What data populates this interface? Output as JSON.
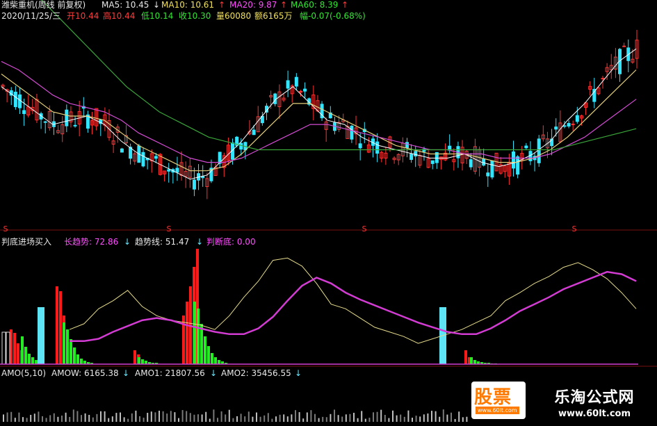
{
  "header": {
    "stock_name": "潍柴重机(周线 前复权)",
    "ma5": "MA5: 10.45",
    "ma5_arrow": "↓",
    "ma10": "MA10: 10.61",
    "ma10_arrow": "↑",
    "ma20": "MA20: 9.87",
    "ma20_arrow": "↑",
    "ma60": "MA60: 8.39",
    "ma60_arrow": "↑",
    "date": "2020/11/25/三",
    "open": "开10.44",
    "high": "高10.44",
    "low": "低10.14",
    "close": "收10.30",
    "volume": "量60080",
    "amount": "额6165万",
    "change": "幅-0.07(-0.68%)"
  },
  "indicator": {
    "name": "判底进场买入",
    "long_trend": "长趋势: 72.86",
    "long_trend_arrow": "↓",
    "trend_line": "趋势线: 51.47",
    "trend_line_arrow": "↓",
    "bottom": "判断底: 0.00"
  },
  "amo": {
    "name": "AMO(5,10)",
    "amow": "AMOW: 6165.38",
    "amow_arrow": "↓",
    "amo1": "AMO1: 21807.56",
    "amo1_arrow": "↓",
    "amo2": "AMO2: 35456.55",
    "amo2_arrow": "↓"
  },
  "markers": [
    "S",
    "S",
    "S",
    "S"
  ],
  "watermark": {
    "logo": "股票",
    "logo_sub": "www.60lt.com",
    "site_name": "乐淘公式网",
    "site_url": "www.60lt.com"
  },
  "colors": {
    "up": "#ff3333",
    "down": "#33e6ff",
    "ma5": "#ffffff",
    "ma10": "#e6d07a",
    "ma20": "#d24bd2",
    "ma60": "#3aa63a",
    "trend": "#e6dc8c",
    "long_trend": "#d23cd2",
    "bar_red": "#ff1a1a",
    "bar_green": "#22ee22",
    "bar_cyan": "#5de4f5"
  },
  "chart_data": [
    {
      "type": "candlestick",
      "title": "潍柴重机(周线 前复权)",
      "series": [
        {
          "name": "MA5",
          "values": [
            11.2,
            10.9,
            10.6,
            10.3,
            10.4,
            10.5,
            10.3,
            9.9,
            9.6,
            9.4,
            9.2,
            9.0,
            9.1,
            9.5,
            9.9,
            10.4,
            10.9,
            11.2,
            10.8,
            10.4,
            10.3,
            10.0,
            9.8,
            9.7,
            9.6,
            9.5,
            9.5,
            9.6,
            9.4,
            9.3,
            9.4,
            9.6,
            9.9,
            10.4,
            10.8,
            11.3,
            11.8,
            12.1
          ]
        },
        {
          "name": "MA10",
          "values": [
            11.5,
            11.2,
            10.9,
            10.6,
            10.5,
            10.5,
            10.4,
            10.1,
            9.8,
            9.6,
            9.4,
            9.2,
            9.2,
            9.3,
            9.6,
            10.0,
            10.4,
            10.8,
            10.8,
            10.6,
            10.4,
            10.2,
            10.0,
            9.8,
            9.7,
            9.6,
            9.6,
            9.6,
            9.5,
            9.4,
            9.4,
            9.5,
            9.7,
            10.0,
            10.4,
            10.8,
            11.2,
            11.6
          ]
        },
        {
          "name": "MA20",
          "values": [
            11.8,
            11.6,
            11.3,
            11.0,
            10.8,
            10.7,
            10.6,
            10.4,
            10.1,
            9.9,
            9.7,
            9.5,
            9.4,
            9.4,
            9.5,
            9.7,
            9.9,
            10.1,
            10.3,
            10.3,
            10.2,
            10.1,
            10.0,
            9.9,
            9.8,
            9.7,
            9.7,
            9.6,
            9.6,
            9.5,
            9.5,
            9.5,
            9.6,
            9.8,
            10.0,
            10.3,
            10.6,
            10.9
          ]
        },
        {
          "name": "MA60",
          "values": [
            13.6,
            13.2,
            12.8,
            12.4,
            12.0,
            11.6,
            11.2,
            10.9,
            10.6,
            10.4,
            10.2,
            10.0,
            9.9,
            9.8,
            9.7,
            9.7,
            9.7,
            9.7,
            9.7,
            9.7,
            9.7,
            9.7,
            9.7,
            9.7,
            9.7,
            9.7,
            9.7,
            9.7,
            9.7,
            9.7,
            9.7,
            9.7,
            9.7,
            9.8,
            9.9,
            10.0,
            10.1,
            10.2
          ]
        }
      ]
    },
    {
      "type": "line",
      "title": "判底进场买入",
      "series": [
        {
          "name": "长趋势",
          "values": [
            20,
            20,
            22,
            28,
            33,
            38,
            40,
            38,
            34,
            31,
            28,
            26,
            26,
            31,
            41,
            55,
            68,
            75,
            70,
            62,
            56,
            51,
            46,
            41,
            36,
            32,
            28,
            26,
            26,
            31,
            38,
            46,
            52,
            58,
            65,
            70,
            75,
            80,
            78,
            72
          ]
        },
        {
          "name": "趋势线",
          "values": [
            30,
            35,
            48,
            55,
            64,
            50,
            42,
            38,
            36,
            34,
            30,
            42,
            58,
            72,
            90,
            92,
            85,
            70,
            52,
            48,
            40,
            32,
            28,
            24,
            18,
            22,
            26,
            30,
            36,
            42,
            55,
            62,
            70,
            76,
            84,
            88,
            82,
            74,
            62,
            48
          ]
        }
      ]
    }
  ]
}
